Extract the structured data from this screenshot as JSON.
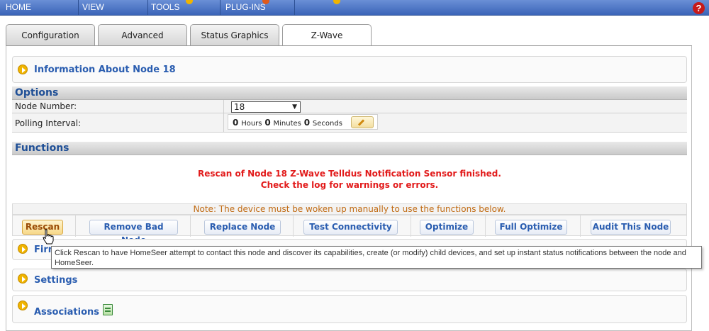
{
  "menu": {
    "items": [
      "HOME",
      "VIEW",
      "TOOLS",
      "PLUG-INS"
    ],
    "help_icon": "?"
  },
  "tabs": [
    "Configuration",
    "Advanced",
    "Status Graphics",
    "Z-Wave"
  ],
  "active_tab": "Z-Wave",
  "info_panel": {
    "title": "Information About Node 18"
  },
  "options": {
    "header": "Options",
    "node_number_label": "Node Number:",
    "node_number_value": "18",
    "polling_label": "Polling Interval:",
    "polling": {
      "hours": "0",
      "hours_unit": "Hours",
      "minutes": "0",
      "minutes_unit": "Minutes",
      "seconds": "0",
      "seconds_unit": "Seconds"
    }
  },
  "functions": {
    "header": "Functions",
    "message_line1": "Rescan of Node 18 Z-Wave Telldus Notification Sensor finished.",
    "message_line2": "Check the log for warnings or errors.",
    "note": "Note: The device must be woken up manually to use the functions below.",
    "buttons": [
      "Rescan",
      "Remove Bad Node",
      "Replace Node",
      "Test Connectivity",
      "Optimize",
      "Full Optimize",
      "Audit This Node"
    ]
  },
  "tooltip": "Click Rescan to have HomeSeer attempt to contact this node and discover its capabilities, create (or modify) child devices, and set up instant status notifications between the node and HomeSeer.",
  "panels": {
    "firmware_partial": "Firm",
    "settings": "Settings",
    "associations": "Associations"
  },
  "colors": {
    "menubar": "#3b64b8",
    "link_blue": "#2a5db0",
    "message_red": "#e21b1b",
    "note_orange": "#c06a12",
    "icon_gold": "#f0b400"
  }
}
